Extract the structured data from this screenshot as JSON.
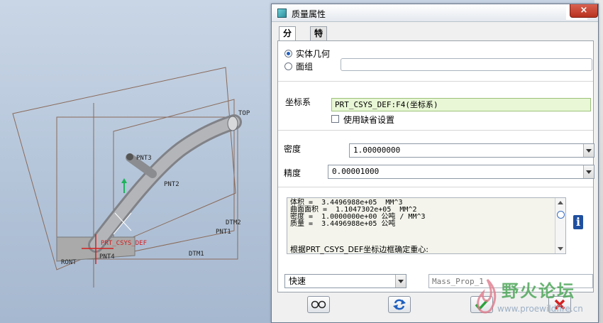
{
  "viewport": {
    "labels": {
      "top": "TOP",
      "pnt3": "PNT3",
      "pnt2": "PNT2",
      "dtm2": "DTM2",
      "pnt1": "PNT1",
      "prt_csys": "PRT_CSYS_DEF",
      "pnt4": "PNT4",
      "dtm1": "DTM1",
      "front": "RONT"
    }
  },
  "dialog": {
    "title": "质量属性",
    "tabs": [
      {
        "label": "分析",
        "active": true
      },
      {
        "label": "特征",
        "active": false
      }
    ],
    "geometry_options": [
      {
        "label": "实体几何",
        "selected": true
      },
      {
        "label": "面组",
        "selected": false
      }
    ],
    "surface_value": "",
    "csys_label": "坐标系",
    "csys_value": "PRT_CSYS_DEF:F4(坐标系)",
    "use_default_label": "使用缺省设置",
    "density_label": "密度",
    "density_value": "1.00000000",
    "accuracy_label": "精度",
    "accuracy_value": "0.00001000",
    "results_text": "体积 =  3.4496988e+05  MM^3\n曲面面积 =  1.1047302e+05  MM^2\n密度 =  1.0000000e+00 公吨 / MM^3\n质量 =  3.4496988e+05 公吨",
    "results_note": "根据PRT_CSYS_DEF坐标边框确定重心:",
    "mode_value": "快速",
    "name_placeholder": "Mass_Prop_1",
    "buttons": {
      "preview_icon": "glasses-icon",
      "repeat_icon": "refresh-icon",
      "ok_icon": "checkmark-icon",
      "cancel_icon": "cross-icon"
    },
    "accent_color": "#1f5fbf"
  },
  "watermark": {
    "text": "野火论坛",
    "url": "www.proewildfire.cn"
  }
}
